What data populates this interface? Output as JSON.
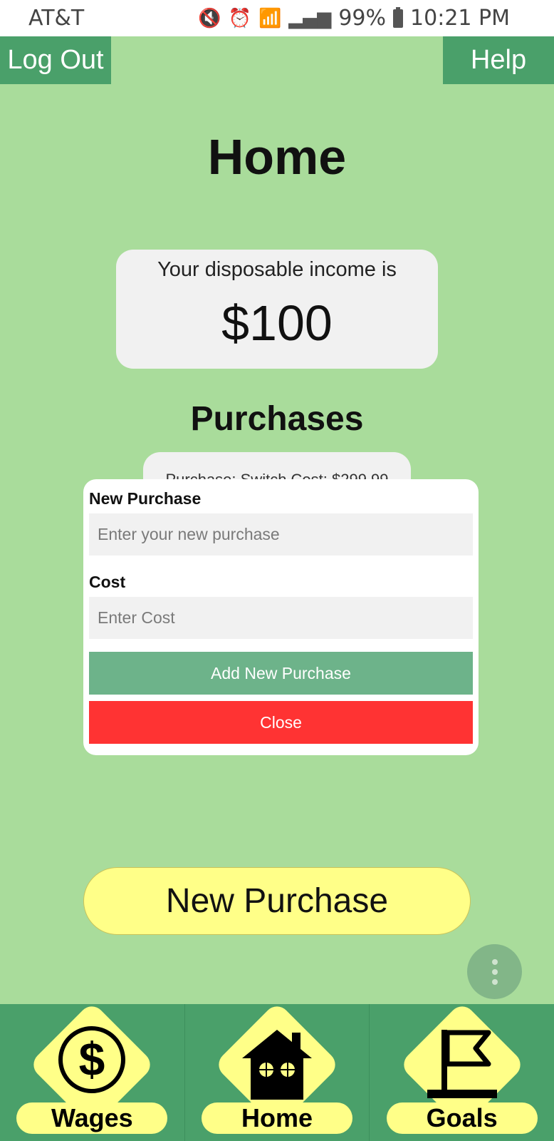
{
  "status_bar": {
    "carrier": "AT&T",
    "battery_percent": "99%",
    "time": "10:21 PM",
    "icons": [
      "mute-icon",
      "alarm-icon",
      "wifi-icon",
      "signal-icon",
      "battery-icon"
    ]
  },
  "header": {
    "logout_label": "Log Out",
    "help_label": "Help",
    "page_title": "Home"
  },
  "income": {
    "label": "Your disposable income is",
    "value": "$100"
  },
  "purchases": {
    "title": "Purchases",
    "items": [
      {
        "text": "Purchase: Switch Cost: $299.99"
      }
    ]
  },
  "modal": {
    "purchase_label": "New Purchase",
    "purchase_placeholder": "Enter your new purchase",
    "cost_label": "Cost",
    "cost_placeholder": "Enter Cost",
    "add_label": "Add New Purchase",
    "close_label": "Close"
  },
  "new_purchase_label": "New Purchase",
  "tabs": [
    {
      "label": "Wages",
      "icon": "dollar-icon"
    },
    {
      "label": "Home",
      "icon": "house-icon"
    },
    {
      "label": "Goals",
      "icon": "flag-icon"
    }
  ],
  "colors": {
    "background": "#a9dc9b",
    "primary_green": "#4aa06a",
    "accent_yellow": "#ffff88",
    "close_red": "#ff3333",
    "add_green": "#6db38a"
  }
}
